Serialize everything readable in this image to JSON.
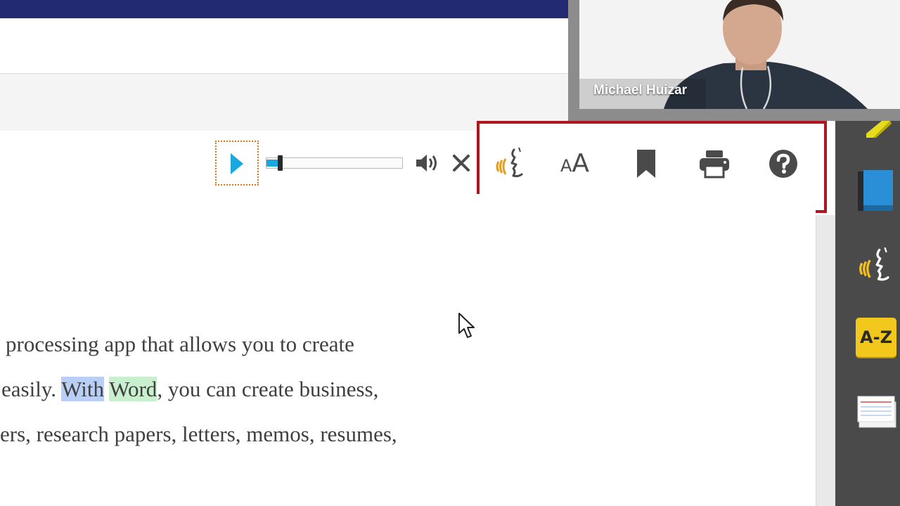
{
  "webcam": {
    "participant_name": "Michael Huizar"
  },
  "player": {
    "play_icon": "play-icon",
    "progress_fraction": 0.1,
    "volume_icon": "volume-icon",
    "close_icon": "close-icon"
  },
  "tools": {
    "text_to_speech_icon": "speaking-head-icon",
    "text_size_small": "A",
    "text_size_large": "A",
    "bookmark_icon": "bookmark-icon",
    "print_icon": "printer-icon",
    "help_icon": "help-icon"
  },
  "dock": {
    "items": [
      "highlighter-icon",
      "book-icon",
      "speaking-head-icon",
      "dictionary",
      "notecards-icon"
    ],
    "dictionary_label": "A-Z"
  },
  "content": {
    "line1": "processing app that allows you to create",
    "line2_before": "easily. ",
    "line2_hl_blue": "With",
    "line2_space": " ",
    "line2_hl_green": "Word",
    "line2_after": ", you can create business,",
    "line3": "ers, research papers, letters, memos, resumes,"
  },
  "colors": {
    "topbar": "#222a72",
    "highlight_frame": "#b0141c",
    "accent_blue": "#1aa7e0",
    "dock_bg": "#4a4a4a",
    "dictionary_yellow": "#f2c81d"
  }
}
